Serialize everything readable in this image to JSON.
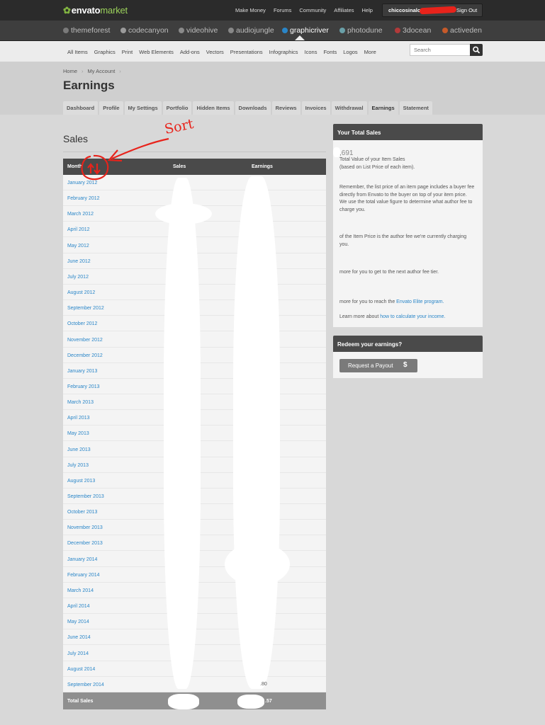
{
  "topbar": {
    "logo_main": "envato",
    "logo_accent": "market",
    "nav": [
      "Make Money",
      "Forums",
      "Community",
      "Affiliates",
      "Help"
    ],
    "username": "chiccosinalo",
    "signout": "Sign Out"
  },
  "markets": [
    {
      "name": "themeforest",
      "color": "#7a7a7a"
    },
    {
      "name": "codecanyon",
      "color": "#9b9b9b"
    },
    {
      "name": "videohive",
      "color": "#8a8a8a"
    },
    {
      "name": "audiojungle",
      "color": "#888888"
    },
    {
      "name": "graphicriver",
      "color": "#2a86c8"
    },
    {
      "name": "photodune",
      "color": "#6aa0a8"
    },
    {
      "name": "3docean",
      "color": "#b23a3a"
    },
    {
      "name": "activeden",
      "color": "#c65a2a"
    }
  ],
  "active_market": "graphicriver",
  "categories": [
    "All Items",
    "Graphics",
    "Print",
    "Web Elements",
    "Add-ons",
    "Vectors",
    "Presentations",
    "Infographics",
    "Icons",
    "Fonts",
    "Logos",
    "More"
  ],
  "search": {
    "placeholder": "Search"
  },
  "breadcrumb": [
    "Home",
    "My Account"
  ],
  "page_title": "Earnings",
  "tabs": [
    "Dashboard",
    "Profile",
    "My Settings",
    "Portfolio",
    "Hidden Items",
    "Downloads",
    "Reviews",
    "Invoices",
    "Withdrawal",
    "Earnings",
    "Statement"
  ],
  "active_tab": "Earnings",
  "sales": {
    "heading": "Sales",
    "columns": [
      "Month",
      "Sales",
      "Earnings"
    ],
    "months": [
      "January 2012",
      "February 2012",
      "March 2012",
      "April 2012",
      "May 2012",
      "June 2012",
      "July 2012",
      "August 2012",
      "September 2012",
      "October 2012",
      "November 2012",
      "December 2012",
      "January 2013",
      "February 2013",
      "March 2013",
      "April 2013",
      "May 2013",
      "June 2013",
      "July 2013",
      "August 2013",
      "September 2013",
      "October 2013",
      "November 2013",
      "December 2013",
      "January 2014",
      "February 2014",
      "March 2014",
      "April 2014",
      "May 2014",
      "June 2014",
      "July 2014",
      "August 2014",
      "September 2014"
    ],
    "last_earning_partial": ".80",
    "total_label": "Total Sales",
    "total_earning_partial": ".57"
  },
  "annotation": {
    "text": "Sort",
    "color": "#e8231b"
  },
  "total_panel": {
    "title": "Your Total Sales",
    "value1": ",691",
    "line1": "Total Value of your Item Sales",
    "line1b": "(based on List Price of each item).",
    "para": "Remember, the list price of an item page includes a buyer fee directly from Envato to the buyer on top of your item price. We use the total value figure to determine what author fee to charge you.",
    "line2": "of the Item Price is the author fee we're currently charging you.",
    "line3": "more for you to get to the next author fee tier.",
    "line4a": "more for you to reach the ",
    "line4_link": "Envato Elite program.",
    "line5a": "Learn more about ",
    "line5_link": "how to calculate your income."
  },
  "redeem_panel": {
    "title": "Redeem your earnings?",
    "button": "Request a Payout",
    "button_symbol": "$"
  }
}
